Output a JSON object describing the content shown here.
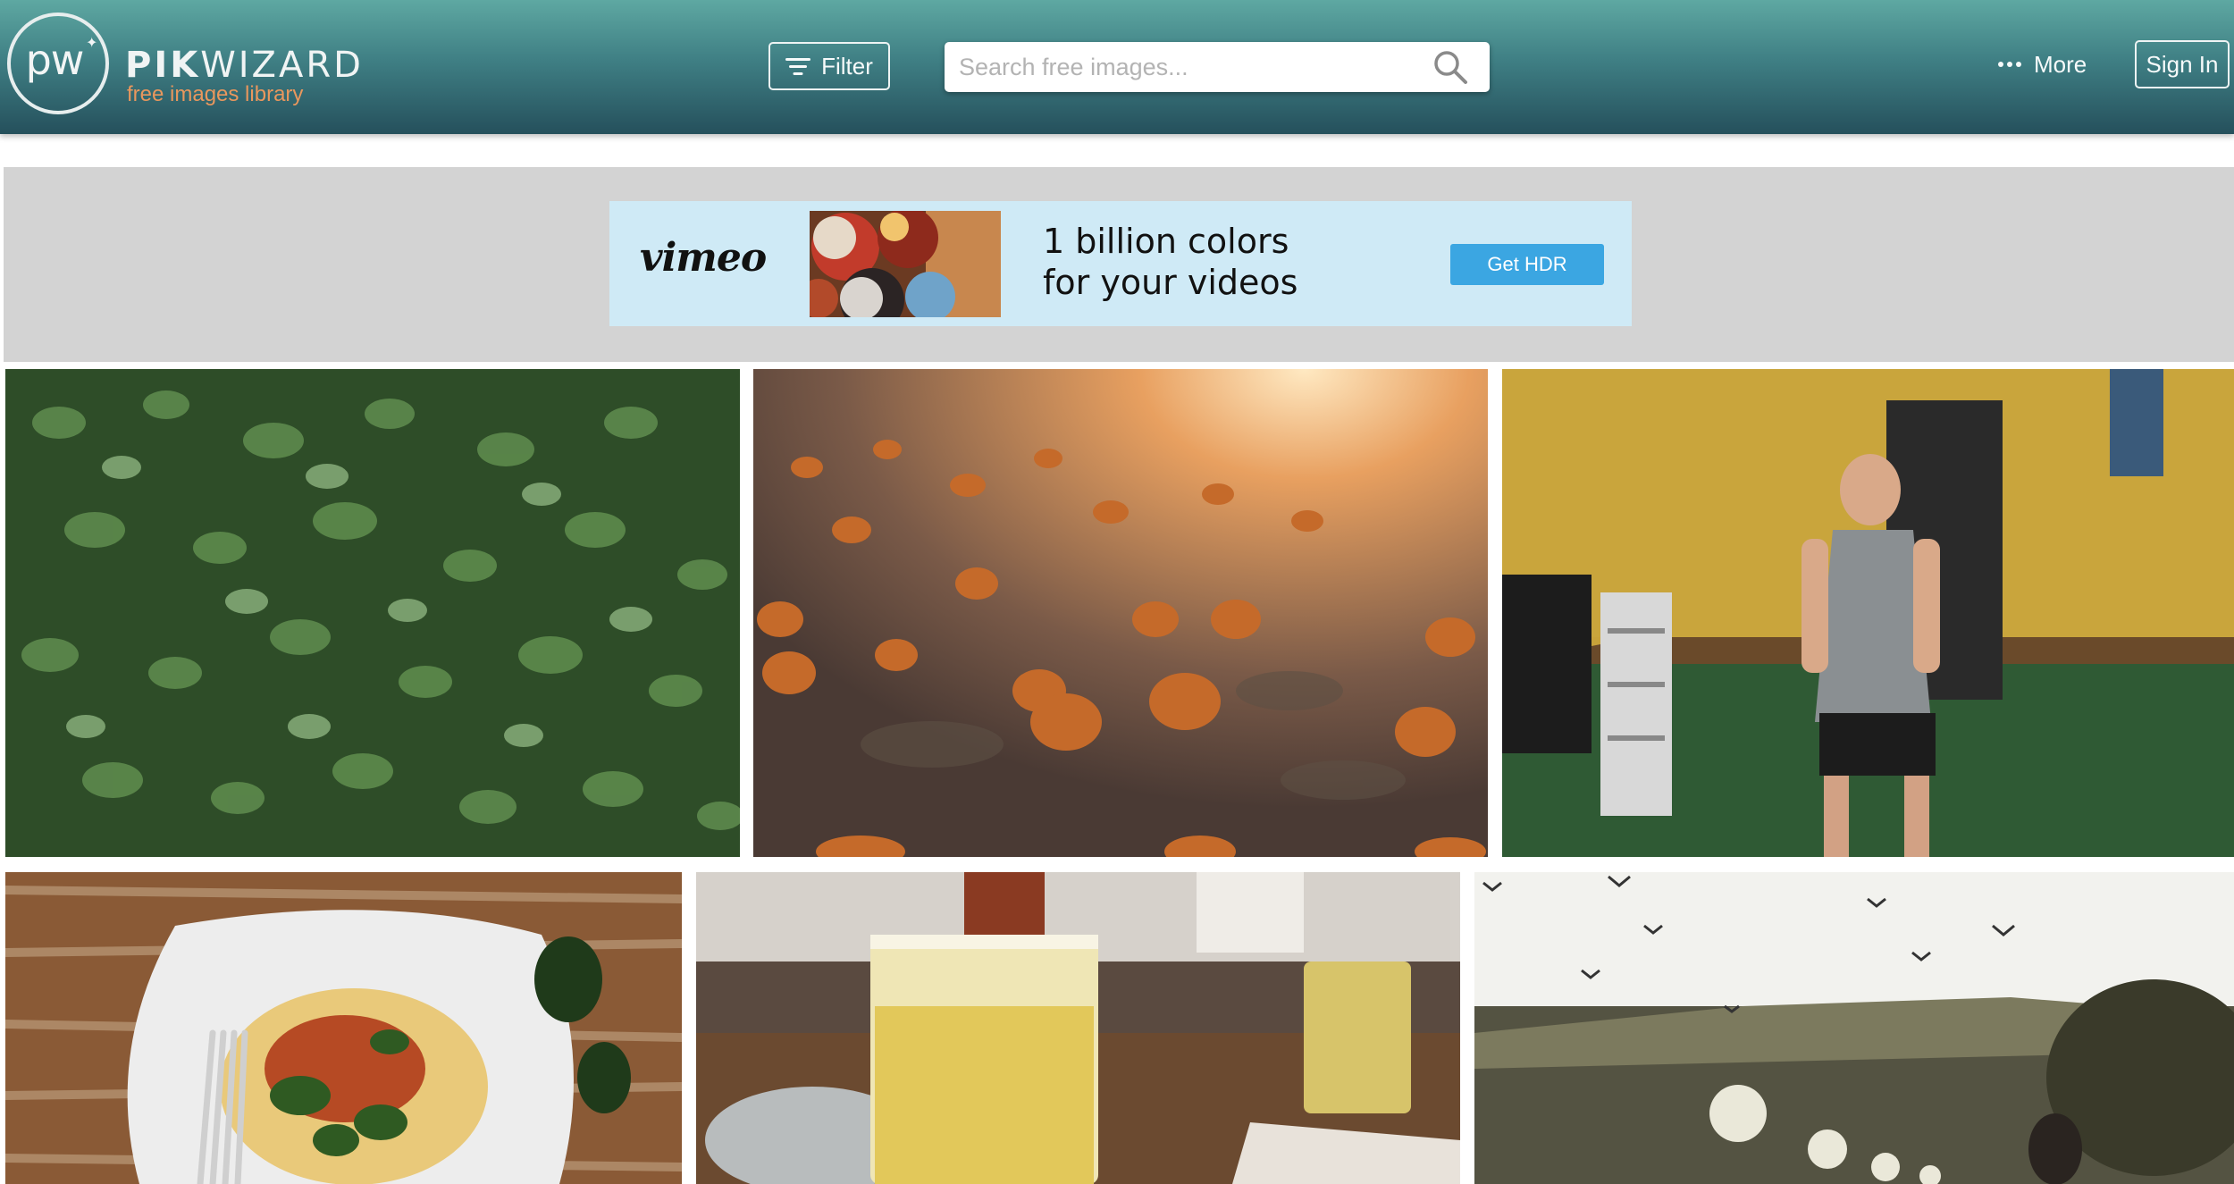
{
  "header": {
    "logo_initials": "pw",
    "logo_name_bold": "PIK",
    "logo_name_light": "WIZARD",
    "logo_tagline": "free images library",
    "filter_label": "Filter",
    "search_placeholder": "Search free images...",
    "more_label": "More",
    "signin_label": "Sign In"
  },
  "ad": {
    "brand": "vimeo",
    "headline_line1": "1 billion colors",
    "headline_line2": "for your videos",
    "cta_label": "Get HDR",
    "cta_color": "#3ba6e2",
    "background_color": "#cfeaf6"
  },
  "gallery": {
    "photos": [
      {
        "subject": "green shrub leaves"
      },
      {
        "subject": "pumpkin field at sunset"
      },
      {
        "subject": "man boxing in gym"
      },
      {
        "subject": "pasta plate with fork"
      },
      {
        "subject": "glass of beer at bar"
      },
      {
        "subject": "birds over countryside"
      }
    ]
  },
  "colors": {
    "header_top": "#5ea8a2",
    "header_bottom": "#25505c",
    "logo_tagline": "#e9975d"
  }
}
